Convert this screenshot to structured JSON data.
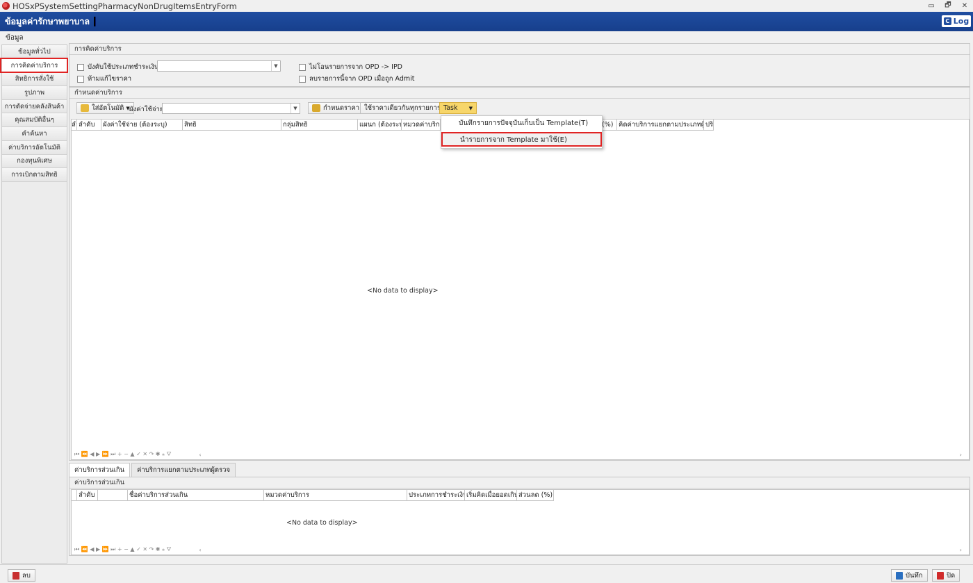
{
  "window": {
    "title": "HOSxPSystemSettingPharmacyNonDrugItemsEntryForm",
    "controls": [
      "▭",
      "🗗",
      "✕"
    ]
  },
  "header": {
    "title": "ข้อมูลค่ารักษาพยาบาล",
    "log_label": "Log"
  },
  "menu": {
    "item": "ข้อมูล"
  },
  "sidebar": {
    "items": [
      {
        "label": "ข้อมูลทั่วไป"
      },
      {
        "label": "การคิดค่าบริการ"
      },
      {
        "label": "สิทธิการสั่งใช้"
      },
      {
        "label": "รูปภาพ"
      },
      {
        "label": "การตัดจ่ายคลังสินค้า"
      },
      {
        "label": "คุณสมบัติอื่นๆ"
      },
      {
        "label": "คำค้นหา"
      },
      {
        "label": "ค่าบริการอัตโนมัติ"
      },
      {
        "label": "กองทุนพิเศษ"
      },
      {
        "label": "การเบิกตามสิทธิ"
      }
    ],
    "active_index": 1
  },
  "billing": {
    "title": "การคิดค่าบริการ",
    "force_payment_type": "บังคับใช้ประเภทชำระเงิน",
    "no_price_edit": "ห้ามแก้ไขราคา",
    "no_transfer_opd_ipd": "ไม่โอนรายการจาก OPD -> IPD",
    "delete_opd_on_admit": "ลบรายการนี้จาก OPD เมื่อถูก Admit"
  },
  "service": {
    "title": "กำหนดค่าบริการ",
    "auto_fill_btn": "ใส่อัตโนมัติ",
    "expense_label": "ผังค่าใช้จ่าย",
    "set_price_btn": "กำหนดราคา",
    "same_price_btn": "ใช้ราคาเดียวกันทุกรายการ",
    "task_btn": "Task",
    "columns": [
      "ลำดับ",
      "ผังค่าใช้จ่าย (ต้องระบุ)",
      "สิทธิ",
      "กลุ่มสิทธิ",
      "แผนก (ต้องระบุ)",
      "หมวดค่าบริการ",
      "",
      "(%)",
      "คิดค่าบริการแยกตามประเภทผู้ต",
      "ปริ"
    ],
    "no_data": "<No data to display>"
  },
  "task_menu": {
    "items": [
      "บันทึกรายการปัจจุบันเก็บเป็น Template(T)",
      "นำรายการจาก Template มาใช้(E)"
    ],
    "selected_index": 1
  },
  "bottom": {
    "tabs": [
      "ค่าบริการส่วนเกิน",
      "ค่าบริการแยกตามประเภทผู้ตรวจ"
    ],
    "group_title": "ค่าบริการส่วนเกิน",
    "columns": [
      "ลำดับ",
      "",
      "ชื่อค่าบริการส่วนเกิน",
      "หมวดค่าบริการ",
      "ประเภทการชำระเงิน",
      "เริ่มคิดเมื่อยอดเกิน",
      "ส่วนลด (%)"
    ],
    "no_data": "<No data to display>"
  },
  "navigator": {
    "glyphs": "⏮ ⏪ ◀ ▶ ⏩ ⏭ + − ▲ ✓ ✕ ↷ ✱ ⁎ ⛛"
  },
  "footer": {
    "delete_label": "ลบ",
    "save_label": "บันทึก",
    "close_label": "ปิด"
  },
  "colors": {
    "header_blue": "#1f4da0",
    "highlight_red": "#e02424",
    "task_yellow": "#f7d66a"
  }
}
